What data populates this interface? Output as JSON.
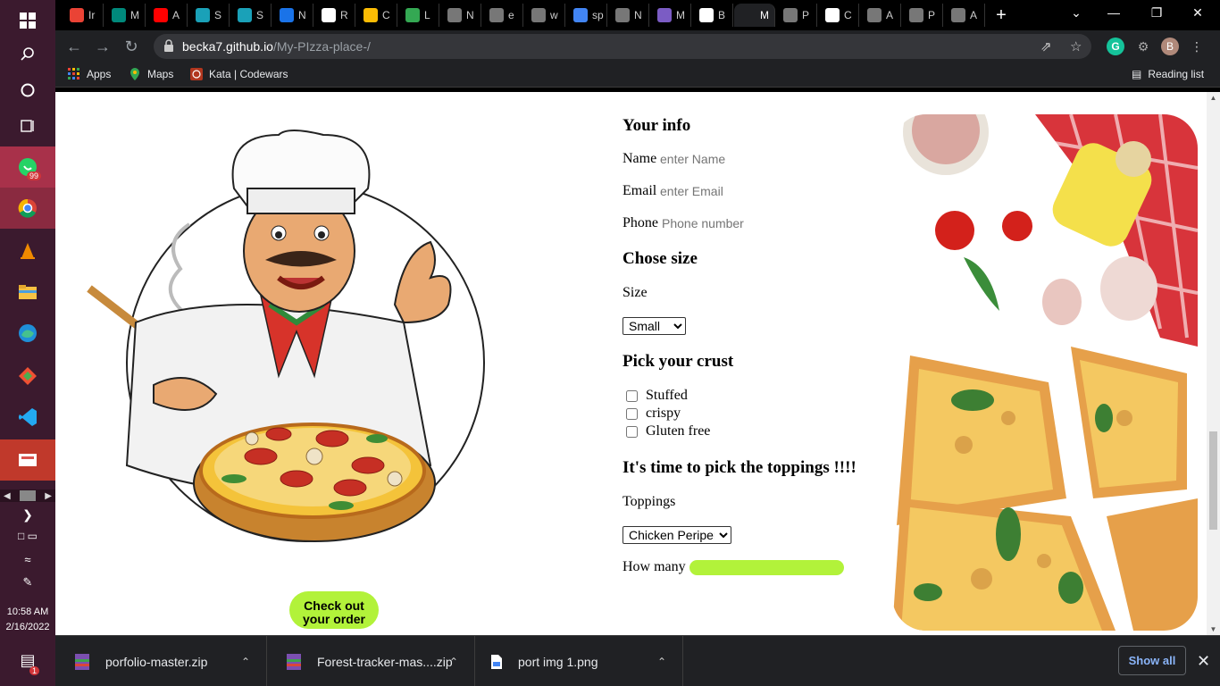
{
  "browser": {
    "tabs": [
      {
        "label": "Ir",
        "icon": "gmail-icon",
        "color": "#ea4335"
      },
      {
        "label": "M",
        "icon": "meet-icon",
        "color": "#00897b"
      },
      {
        "label": "A",
        "icon": "youtube-icon",
        "color": "#ff0000"
      },
      {
        "label": "S",
        "icon": "figma-icon",
        "color": "#1aa1b8"
      },
      {
        "label": "S",
        "icon": "figma-icon",
        "color": "#1aa1b8"
      },
      {
        "label": "N",
        "icon": "bookmark-icon",
        "color": "#1a73e8"
      },
      {
        "label": "R",
        "icon": "react-icon",
        "color": "#ffffff"
      },
      {
        "label": "C",
        "icon": "chrome-icon",
        "color": "#fbbc04"
      },
      {
        "label": "L",
        "icon": "w-icon",
        "color": "#34a853"
      },
      {
        "label": "N",
        "icon": "globe-icon",
        "color": "#777777"
      },
      {
        "label": "e",
        "icon": "globe-icon",
        "color": "#777777"
      },
      {
        "label": "w",
        "icon": "globe-icon",
        "color": "#777777"
      },
      {
        "label": "sp",
        "icon": "google-icon",
        "color": "#4285f4"
      },
      {
        "label": "N",
        "icon": "globe-icon",
        "color": "#777777"
      },
      {
        "label": "M",
        "icon": "b-icon",
        "color": "#7b5cc4"
      },
      {
        "label": "B",
        "icon": "github-icon",
        "color": "#ffffff"
      },
      {
        "label": "M",
        "icon": "page-icon",
        "color": "#202124",
        "active": true
      },
      {
        "label": "P",
        "icon": "globe-icon",
        "color": "#777777"
      },
      {
        "label": "C",
        "icon": "a-icon",
        "color": "#ffffff"
      },
      {
        "label": "A",
        "icon": "globe-icon",
        "color": "#777777"
      },
      {
        "label": "P",
        "icon": "globe-icon",
        "color": "#777777"
      },
      {
        "label": "A",
        "icon": "globe-icon",
        "color": "#777777"
      }
    ],
    "url_host": "becka7.github.io",
    "url_path": "/My-PIzza-place-/",
    "profile_initial": "B",
    "bookmarks": [
      {
        "label": "Apps",
        "icon": "apps-grid-icon"
      },
      {
        "label": "Maps",
        "icon": "maps-pin-icon"
      },
      {
        "label": "Kata | Codewars",
        "icon": "codewars-icon"
      }
    ],
    "reading_list": "Reading list"
  },
  "form": {
    "your_info_heading": "Your info",
    "name_label": "Name",
    "name_placeholder": "enter Name",
    "email_label": "Email",
    "email_placeholder": "enter Email",
    "phone_label": "Phone",
    "phone_placeholder": "Phone number",
    "size_heading": "Chose size",
    "size_label": "Size",
    "size_value": "Small",
    "crust_heading": "Pick your crust",
    "crust_options": [
      "Stuffed",
      "crispy",
      "Gluten free"
    ],
    "toppings_heading": "It's time to pick the toppings !!!!",
    "toppings_label": "Toppings",
    "toppings_value": "Chicken Periperi",
    "how_many_label": "How many"
  },
  "checkout_label_1": "Check out",
  "checkout_label_2": "your order",
  "downloads": [
    {
      "name": "porfolio-master.zip",
      "icon": "zip-file-icon"
    },
    {
      "name": "Forest-tracker-mas....zip",
      "icon": "zip-file-icon"
    },
    {
      "name": "port img 1.png",
      "icon": "image-file-icon"
    }
  ],
  "show_all": "Show all",
  "taskbar": {
    "time": "10:58 AM",
    "date": "2/16/2022",
    "whatsapp_badge": "99",
    "notification_badge": "1"
  },
  "colors": {
    "accent_green": "#b2f23a",
    "taskbar": "#3b1a2e",
    "chrome_dark": "#202124"
  }
}
